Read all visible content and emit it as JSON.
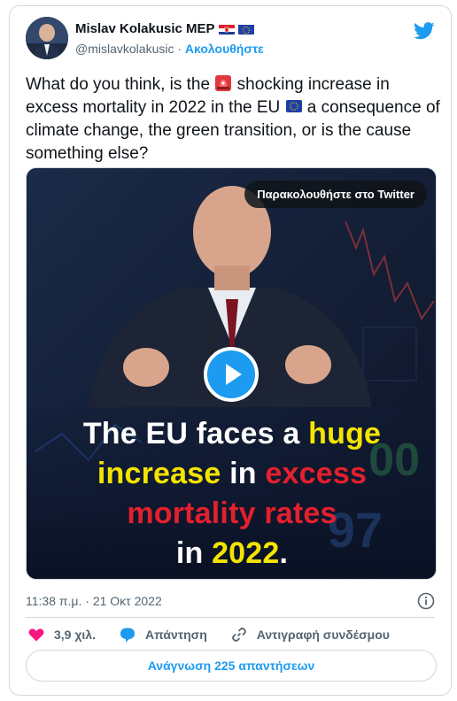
{
  "tweet": {
    "author": {
      "name": "Mislav Kolakusic MEP",
      "handle": "@mislavkolakusic",
      "separator": " · ",
      "follow_label": "Ακολουθήστε",
      "avatar_icon": "profile-photo",
      "flags": [
        "croatia-flag",
        "eu-flag"
      ]
    },
    "text": {
      "part1": "What do you think, is the ",
      "part2": " shocking increase in excess mortality in 2022 in the EU ",
      "part3": " a consequence of climate change, the green transition, or is the cause something else?",
      "emoji1": "siren-emoji",
      "emoji2": "eu-flag-emoji"
    },
    "media": {
      "watch_label": "Παρακολουθήστε στο Twitter",
      "caption": {
        "w1": "The EU faces a ",
        "w2": "huge",
        "w3": "increase",
        "w4": " in ",
        "w5": "excess",
        "w6": "mortality rates",
        "w7": "in ",
        "w8": "2022",
        "w9": "."
      },
      "bg_numbers": [
        "00",
        "97"
      ]
    },
    "timestamp": "11:38 π.μ. · 21 Οκτ 2022",
    "actions": {
      "likes": "3,9 χιλ.",
      "reply_label": "Απάντηση",
      "copy_label": "Αντιγραφή συνδέσμου"
    },
    "read_replies_label": "Ανάγνωση 225 απαντήσεων"
  },
  "colors": {
    "accent": "#1d9bf0",
    "like": "#f91880",
    "caption_yellow": "#f5e400",
    "caption_red": "#e3202d"
  }
}
